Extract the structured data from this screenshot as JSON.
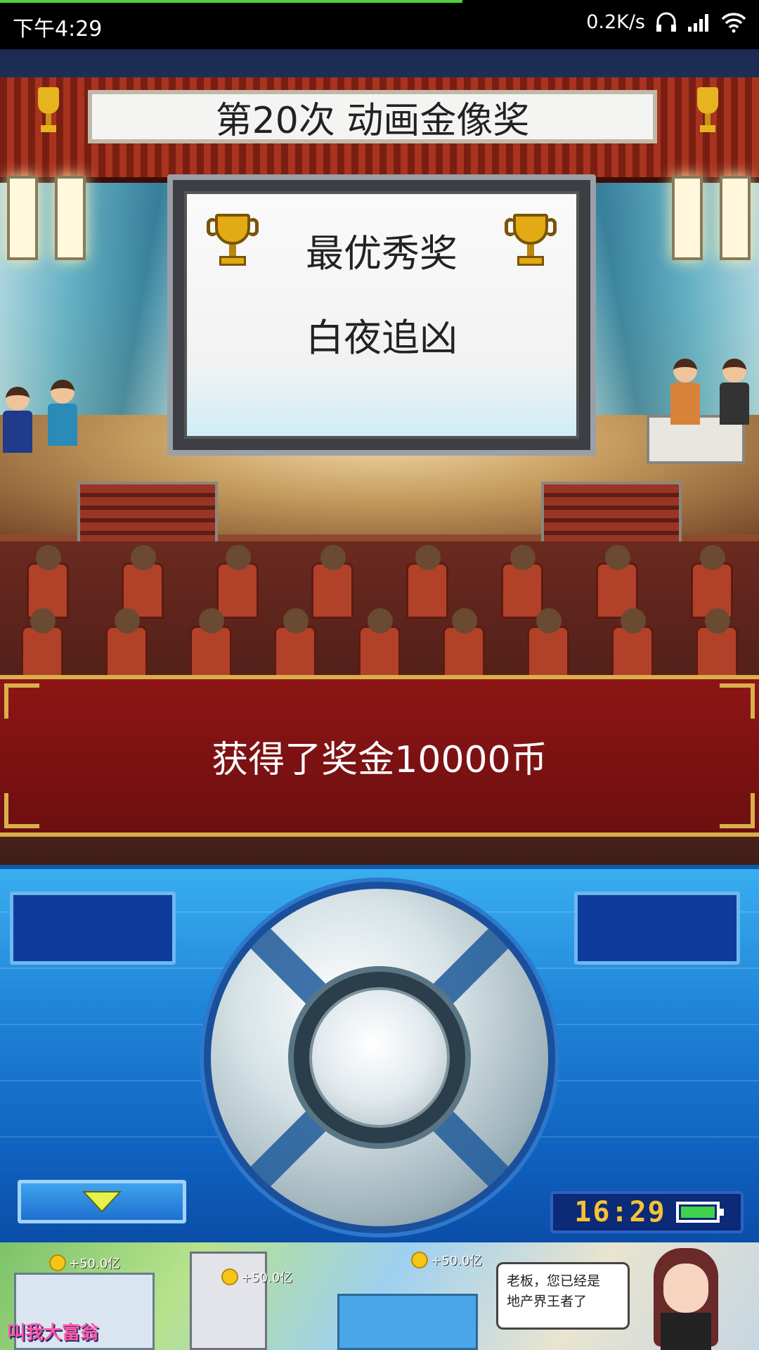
{
  "status_bar": {
    "time": "下午4:29",
    "net_speed": "0.2K/s",
    "icons": [
      "headphones-icon",
      "signal-icon",
      "wifi-icon"
    ]
  },
  "scene": {
    "event_title": "第20次 动画金像奖",
    "award_category": "最优秀奖",
    "award_winner": "白夜追凶",
    "reward_message": "获得了奖金10000币"
  },
  "controller": {
    "clock": "16:29",
    "battery_level": 1.0,
    "down_icon": "down-triangle-icon"
  },
  "ad": {
    "coin_badges": [
      "+50.0亿",
      "+50.0亿",
      "+50.0亿"
    ],
    "bubble_line1": "老板，您已经是",
    "bubble_line2": "地产界王者了",
    "logo": "叫我大富翁"
  },
  "colors": {
    "accent_blue": "#1e82d6",
    "reward_red": "#8e1515",
    "gold": "#d9b04a",
    "clock_yellow": "#f6c234"
  }
}
